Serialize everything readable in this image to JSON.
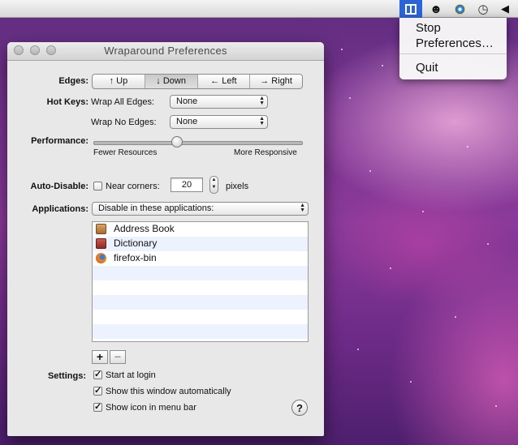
{
  "menubar": {
    "wraparound_icon": "wraparound-icon",
    "icons": [
      "wraparound-icon",
      "character-icon",
      "disc-icon",
      "time-machine-icon",
      "speaker-icon"
    ]
  },
  "status_menu": {
    "items": [
      {
        "label": "Stop"
      },
      {
        "label": "Preferences…"
      },
      {
        "label": "Quit"
      }
    ]
  },
  "window": {
    "title": "Wraparound Preferences"
  },
  "edges": {
    "label": "Edges:",
    "options": [
      "↑ Up",
      "↓ Down",
      "← Left",
      "→ Right"
    ],
    "selected": "↓ Down"
  },
  "hotkeys": {
    "label": "Hot Keys:",
    "wrap_all_label": "Wrap All Edges:",
    "wrap_all_value": "None",
    "wrap_no_label": "Wrap No Edges:",
    "wrap_no_value": "None"
  },
  "performance": {
    "label": "Performance:",
    "min_label": "Fewer Resources",
    "max_label": "More Responsive",
    "value_fraction": 0.4
  },
  "auto_disable": {
    "label": "Auto-Disable:",
    "checkbox_label": "Near corners:",
    "checked": false,
    "value": "20",
    "unit": "pixels"
  },
  "applications": {
    "label": "Applications:",
    "mode_value": "Disable in these applications:",
    "items": [
      {
        "name": "Address Book",
        "icon": "address-book-icon"
      },
      {
        "name": "Dictionary",
        "icon": "dictionary-icon"
      },
      {
        "name": "firefox-bin",
        "icon": "firefox-icon"
      }
    ],
    "add_label": "+",
    "remove_label": "−"
  },
  "settings": {
    "label": "Settings:",
    "options": [
      {
        "label": "Start at login",
        "checked": true
      },
      {
        "label": "Show this window automatically",
        "checked": true
      },
      {
        "label": "Show icon in menu bar",
        "checked": true
      }
    ],
    "help_label": "?"
  },
  "colors": {
    "menu_highlight": "#2a64d8",
    "list_stripe": "#edf3fe"
  }
}
